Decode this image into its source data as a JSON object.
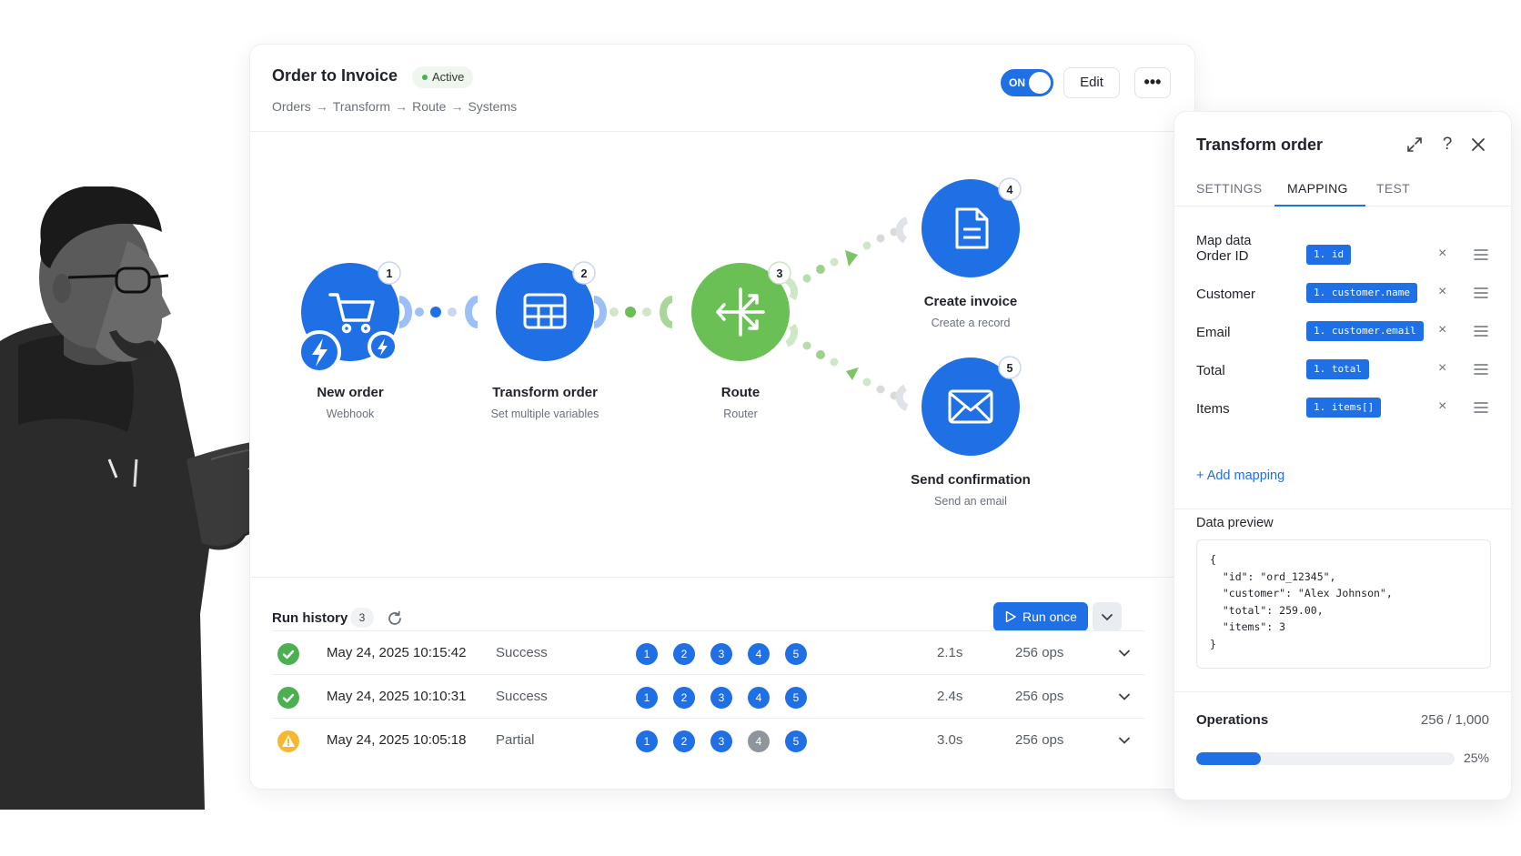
{
  "workflow": {
    "title": "Order to Invoice",
    "status": "Active",
    "breadcrumb": [
      "Orders",
      "Transform",
      "Route",
      "Systems"
    ],
    "toggle_label": "ON",
    "edit_label": "Edit",
    "more_label": "•••"
  },
  "nodes": [
    {
      "num": "1",
      "title": "New order",
      "subtitle": "Webhook",
      "color": "#1f6fe5",
      "icon": "cart-icon"
    },
    {
      "num": "2",
      "title": "Transform order",
      "subtitle": "Set multiple variables",
      "color": "#1f6fe5",
      "icon": "table-icon"
    },
    {
      "num": "3",
      "title": "Route",
      "subtitle": "Router",
      "color": "#6abf55",
      "icon": "router-icon"
    },
    {
      "num": "4",
      "title": "Create invoice",
      "subtitle": "Create a record",
      "color": "#1f6fe5",
      "icon": "document-icon"
    },
    {
      "num": "5",
      "title": "Send confirmation",
      "subtitle": "Send an email",
      "color": "#1f6fe5",
      "icon": "mail-icon"
    }
  ],
  "run_history": {
    "title": "Run history",
    "count": "3",
    "run_once_label": "Run once",
    "runs": [
      {
        "time": "May 24, 2025 10:15:42",
        "status": "Success",
        "state": "success",
        "steps": [
          "1",
          "2",
          "3",
          "4",
          "5"
        ],
        "gray_step": -1,
        "duration": "2.1s",
        "ops": "256 ops"
      },
      {
        "time": "May 24, 2025 10:10:31",
        "status": "Success",
        "state": "success",
        "steps": [
          "1",
          "2",
          "3",
          "4",
          "5"
        ],
        "gray_step": -1,
        "duration": "2.4s",
        "ops": "256 ops"
      },
      {
        "time": "May 24, 2025 10:05:18",
        "status": "Partial",
        "state": "partial",
        "steps": [
          "1",
          "2",
          "3",
          "4",
          "5"
        ],
        "gray_step": 3,
        "duration": "3.0s",
        "ops": "256 ops"
      }
    ]
  },
  "panel": {
    "title": "Transform order",
    "tabs": [
      "SETTINGS",
      "MAPPING",
      "TEST"
    ],
    "active_tab": "MAPPING",
    "map_title": "Map data",
    "mappings": [
      {
        "field": "Order ID",
        "value": "1. id"
      },
      {
        "field": "Customer",
        "value": "1. customer.name"
      },
      {
        "field": "Email",
        "value": "1. customer.email"
      },
      {
        "field": "Total",
        "value": "1. total"
      },
      {
        "field": "Items",
        "value": "1. items[]"
      }
    ],
    "add_mapping_label": "+ Add mapping",
    "preview_title": "Data preview",
    "preview_code": "{\n  \"id\": \"ord_12345\",\n  \"customer\": \"Alex Johnson\",\n  \"total\": 259.00,\n  \"items\": 3\n}",
    "operations_title": "Operations",
    "operations_value": "256 / 1,000",
    "operations_fraction": 0.25,
    "operations_pct": "25%"
  },
  "colors": {
    "accent": "#1f6fe5",
    "router": "#6abf55",
    "success": "#4caf50",
    "warning": "#f5b82e"
  }
}
